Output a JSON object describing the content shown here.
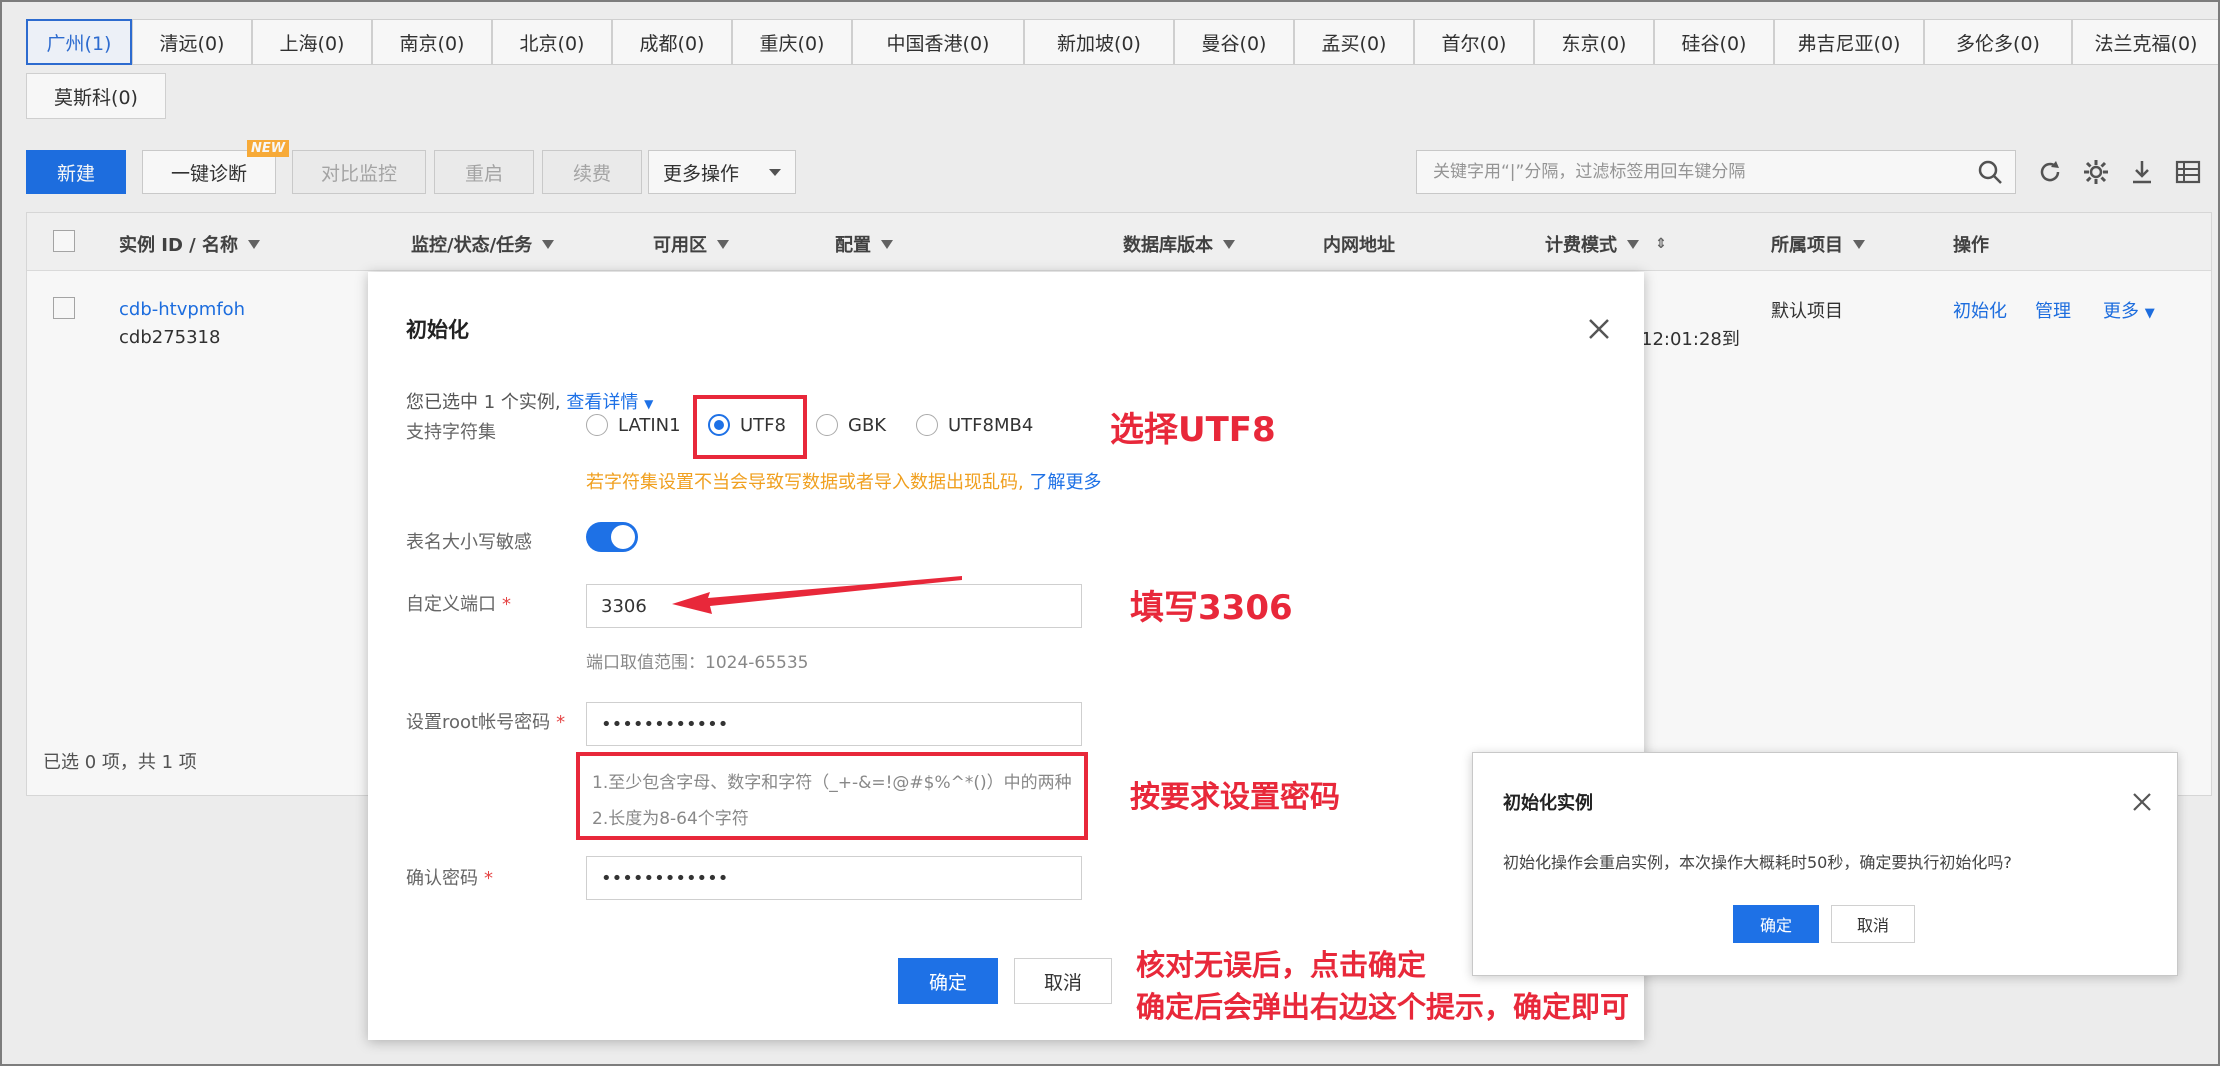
{
  "region_tabs": [
    {
      "label": "广州(1)",
      "active": true
    },
    {
      "label": "清远(0)"
    },
    {
      "label": "上海(0)"
    },
    {
      "label": "南京(0)"
    },
    {
      "label": "北京(0)"
    },
    {
      "label": "成都(0)"
    },
    {
      "label": "重庆(0)"
    },
    {
      "label": "中国香港(0)"
    },
    {
      "label": "新加坡(0)"
    },
    {
      "label": "曼谷(0)"
    },
    {
      "label": "孟买(0)"
    },
    {
      "label": "首尔(0)"
    },
    {
      "label": "东京(0)"
    },
    {
      "label": "硅谷(0)"
    },
    {
      "label": "弗吉尼亚(0)"
    },
    {
      "label": "多伦多(0)"
    },
    {
      "label": "法兰克福(0)"
    },
    {
      "label": "莫斯科(0)"
    }
  ],
  "toolbar": {
    "new_label": "新建",
    "diagnose_label": "一键诊断",
    "new_badge": "NEW",
    "compare_label": "对比监控",
    "restart_label": "重启",
    "renew_label": "续费",
    "more_ops_label": "更多操作",
    "search_placeholder": "关键字用“|”分隔，过滤标签用回车键分隔"
  },
  "table": {
    "headers": {
      "id_name": "实例 ID / 名称",
      "monitor": "监控/状态/任务",
      "zone": "可用区",
      "config": "配置",
      "db_version": "数据库版本",
      "ip": "内网地址",
      "billing": "计费模式",
      "project": "所属项目",
      "ops": "操作"
    },
    "row": {
      "instance_id": "cdb-htvpmfoh",
      "instance_name": "cdb275318",
      "billing_partial": "12:01:28到",
      "project": "默认项目",
      "op_init": "初始化",
      "op_manage": "管理",
      "op_more": "更多"
    },
    "footer": "已选 0 项，共 1 项"
  },
  "dialog": {
    "title": "初始化",
    "selected_text": "您已选中 1 个实例,",
    "view_details": "查看详情",
    "charset_label": "支持字符集",
    "charsets": [
      {
        "label": "LATIN1",
        "checked": false
      },
      {
        "label": "UTF8",
        "checked": true
      },
      {
        "label": "GBK",
        "checked": false
      },
      {
        "label": "UTF8MB4",
        "checked": false
      }
    ],
    "charset_warning": "若字符集设置不当会导致写数据或者导入数据出现乱码,",
    "learn_more": "了解更多",
    "case_sensitive_label": "表名大小写敏感",
    "port_label": "自定义端口",
    "port_value": "3306",
    "port_hint": "端口取值范围：1024-65535",
    "root_pw_label": "设置root帐号密码",
    "root_pw_value": "••••••••••••",
    "pw_rule_1": "1.至少包含字母、数字和字符（_+-&=!@#$%^*()）中的两种",
    "pw_rule_2": "2.长度为8-64个字符",
    "confirm_pw_label": "确认密码",
    "confirm_pw_value": "••••••••••••",
    "ok_label": "确定",
    "cancel_label": "取消"
  },
  "annotations": {
    "select_utf8": "选择UTF8",
    "fill_port": "填写3306",
    "set_password": "按要求设置密码",
    "check_confirm_1": "核对无误后，点击确定",
    "check_confirm_2": "确定后会弹出右边这个提示，确定即可"
  },
  "confirm_dialog": {
    "title": "初始化实例",
    "message": "初始化操作会重启实例，本次操作大概耗时50秒，确定要执行初始化吗?",
    "ok_label": "确定",
    "cancel_label": "取消"
  },
  "colors": {
    "accent": "#1e71e6",
    "annotation_red": "#e8283a",
    "warning": "#f0a020"
  }
}
